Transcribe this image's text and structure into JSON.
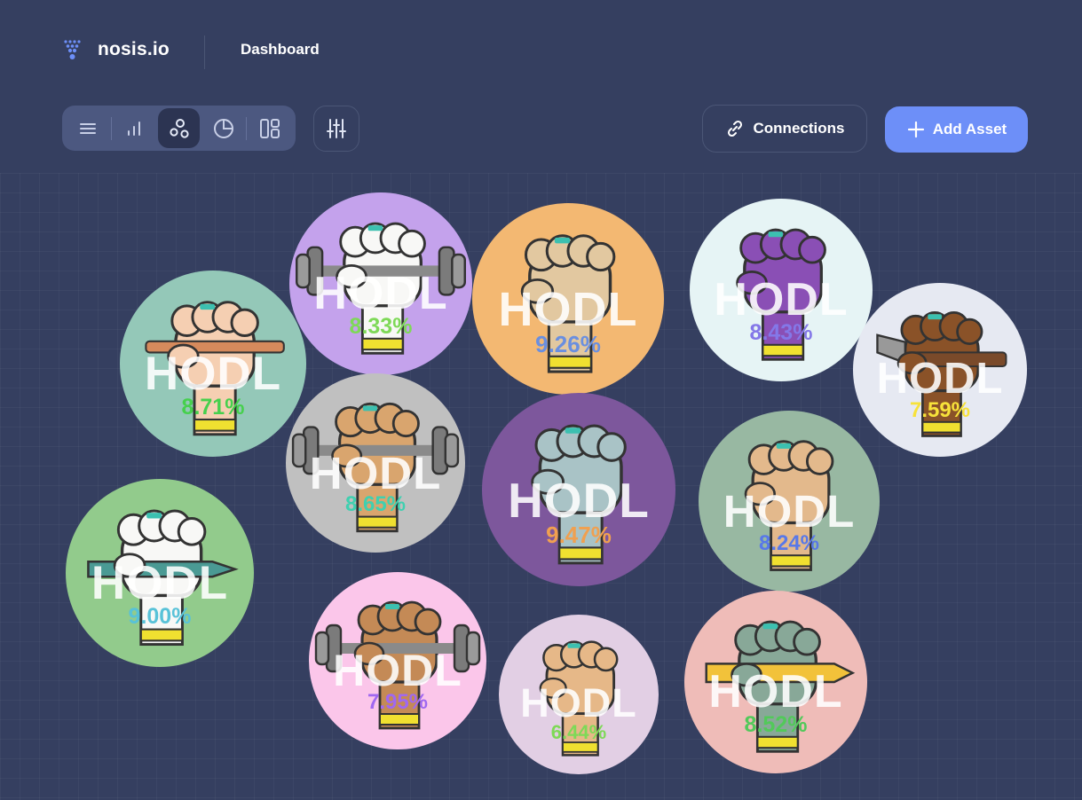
{
  "brand": {
    "name": "nosis.io"
  },
  "header": {
    "page_title": "Dashboard"
  },
  "toolbar": {
    "views": [
      {
        "name": "list-view-button",
        "icon": "list-icon",
        "active": false
      },
      {
        "name": "bar-view-button",
        "icon": "bar-chart-icon",
        "active": false
      },
      {
        "name": "bubble-view-button",
        "icon": "bubbles-icon",
        "active": true
      },
      {
        "name": "pie-view-button",
        "icon": "pie-chart-icon",
        "active": false
      },
      {
        "name": "grid-view-button",
        "icon": "layout-icon",
        "active": false
      }
    ],
    "filter_icon": "sliders-icon",
    "connections_label": "Connections",
    "connections_icon": "link-icon",
    "add_asset_label": "Add Asset",
    "add_asset_icon": "plus-icon"
  },
  "colors": {
    "background": "#353f60",
    "accent": "#6d8ff8"
  },
  "assets": [
    {
      "label": "HODL",
      "percent": "8.33%",
      "bg": "#c4a2ec",
      "pct_color": "#7ed957",
      "prop": "dumbbell",
      "skin": "#f8f8f6"
    },
    {
      "label": "HODL",
      "percent": "9.26%",
      "bg": "#f3b872",
      "pct_color": "#6a8fe0",
      "prop": "bandage",
      "skin": "#e2c8a0"
    },
    {
      "label": "HODL",
      "percent": "8.43%",
      "bg": "#e6f4f5",
      "pct_color": "#8478e8",
      "prop": "none",
      "skin": "#8a4fb5"
    },
    {
      "label": "HODL",
      "percent": "8.71%",
      "bg": "#94c8b8",
      "pct_color": "#46d04d",
      "prop": "stick",
      "skin": "#f5cfb2"
    },
    {
      "label": "HODL",
      "percent": "7.59%",
      "bg": "#e6e9f2",
      "pct_color": "#f7e23a",
      "prop": "hammer",
      "skin": "#8a5228"
    },
    {
      "label": "HODL",
      "percent": "8.65%",
      "bg": "#c0c0c0",
      "pct_color": "#3fd0b0",
      "prop": "dumbbell",
      "skin": "#d9a56e"
    },
    {
      "label": "HODL",
      "percent": "9.47%",
      "bg": "#7d579c",
      "pct_color": "#f0a050",
      "prop": "none",
      "skin": "#a9c3c6"
    },
    {
      "label": "HODL",
      "percent": "8.24%",
      "bg": "#98b8a2",
      "pct_color": "#5878e8",
      "prop": "none",
      "skin": "#e3b98c"
    },
    {
      "label": "HODL",
      "percent": "9.00%",
      "bg": "#92cb8c",
      "pct_color": "#58c2d8",
      "prop": "pen",
      "skin": "#f8f8f6"
    },
    {
      "label": "HODL",
      "percent": "7.95%",
      "bg": "#fbc6ea",
      "pct_color": "#a068f0",
      "prop": "dumbbell",
      "skin": "#c48a56"
    },
    {
      "label": "HODL",
      "percent": "6.44%",
      "bg": "#e2cfe4",
      "pct_color": "#7ed957",
      "prop": "none",
      "skin": "#e6b888"
    },
    {
      "label": "HODL",
      "percent": "8.52%",
      "bg": "#efbcb8",
      "pct_color": "#52c95a",
      "prop": "pencil",
      "skin": "#88a898"
    }
  ]
}
